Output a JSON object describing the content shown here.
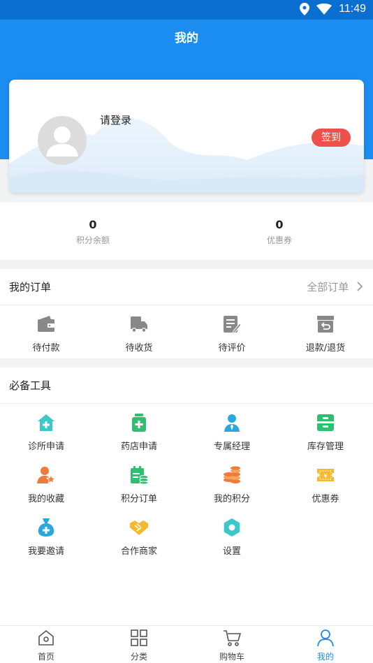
{
  "status_bar": {
    "time": "11:49"
  },
  "header": {
    "title": "我的"
  },
  "profile": {
    "login_text": "请登录",
    "signin_label": "签到"
  },
  "stats": [
    {
      "value": "0",
      "label": "积分余额"
    },
    {
      "value": "0",
      "label": "优惠券"
    }
  ],
  "orders": {
    "title": "我的订单",
    "all_label": "全部订单",
    "items": [
      {
        "label": "待付款",
        "icon": "wallet-icon"
      },
      {
        "label": "待收货",
        "icon": "truck-icon"
      },
      {
        "label": "待评价",
        "icon": "review-icon"
      },
      {
        "label": "退款/退货",
        "icon": "refund-icon"
      }
    ]
  },
  "tools": {
    "title": "必备工具",
    "items": [
      {
        "label": "诊所申请",
        "icon": "clinic-icon",
        "color": "#3cc7c9"
      },
      {
        "label": "药店申请",
        "icon": "pharmacy-icon",
        "color": "#2fbf71"
      },
      {
        "label": "专属经理",
        "icon": "manager-icon",
        "color": "#29a8e0"
      },
      {
        "label": "库存管理",
        "icon": "inventory-icon",
        "color": "#2fbf71"
      },
      {
        "label": "我的收藏",
        "icon": "favorite-icon",
        "color": "#f07a3a"
      },
      {
        "label": "积分订单",
        "icon": "points-order-icon",
        "color": "#2fbf71"
      },
      {
        "label": "我的积分",
        "icon": "points-icon",
        "color": "#f07a3a"
      },
      {
        "label": "优惠券",
        "icon": "coupon-icon",
        "color": "#f5b82e"
      },
      {
        "label": "我要邀请",
        "icon": "invite-icon",
        "color": "#29a8e0"
      },
      {
        "label": "合作商家",
        "icon": "handshake-icon",
        "color": "#f5b82e"
      },
      {
        "label": "设置",
        "icon": "settings-icon",
        "color": "#3cc7c9"
      }
    ]
  },
  "tabbar": [
    {
      "label": "首页",
      "icon": "home-icon",
      "active": false
    },
    {
      "label": "分类",
      "icon": "category-icon",
      "active": false
    },
    {
      "label": "购物车",
      "icon": "cart-icon",
      "active": false
    },
    {
      "label": "我的",
      "icon": "user-icon",
      "active": true
    }
  ],
  "colors": {
    "brand": "#1b8cf0",
    "signin": "#f0504a",
    "active_tab": "#1b8cf0"
  }
}
